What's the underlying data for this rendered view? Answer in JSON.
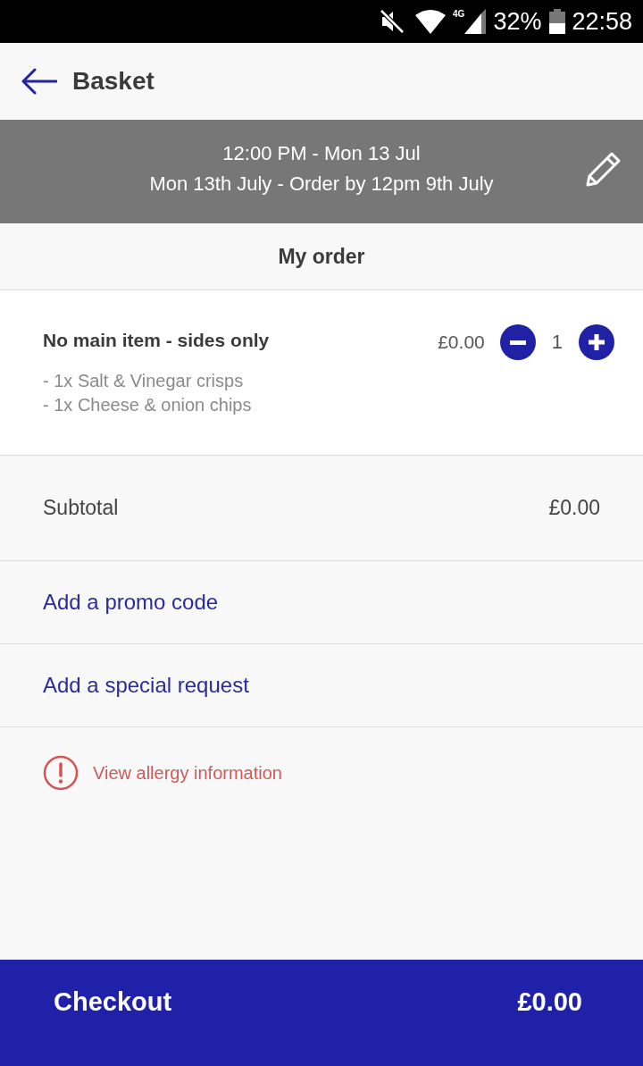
{
  "status_bar": {
    "network_type": "4G",
    "battery_percent": "32%",
    "time": "22:58"
  },
  "header": {
    "title": "Basket"
  },
  "delivery": {
    "time_line": "12:00 PM - Mon 13 Jul",
    "date_line": "Mon 13th July - Order by 12pm 9th July"
  },
  "order": {
    "heading": "My order",
    "items": [
      {
        "name": "No main item - sides only",
        "price": "£0.00",
        "quantity": "1",
        "sides": [
          "- 1x Salt & Vinegar crisps",
          "- 1x Cheese & onion chips"
        ]
      }
    ]
  },
  "subtotal": {
    "label": "Subtotal",
    "amount": "£0.00"
  },
  "promo_link": {
    "label": "Add a promo code"
  },
  "request_link": {
    "label": "Add a special request"
  },
  "allergy_link": {
    "label": "View allergy information"
  },
  "checkout": {
    "label": "Checkout",
    "total": "£0.00"
  }
}
